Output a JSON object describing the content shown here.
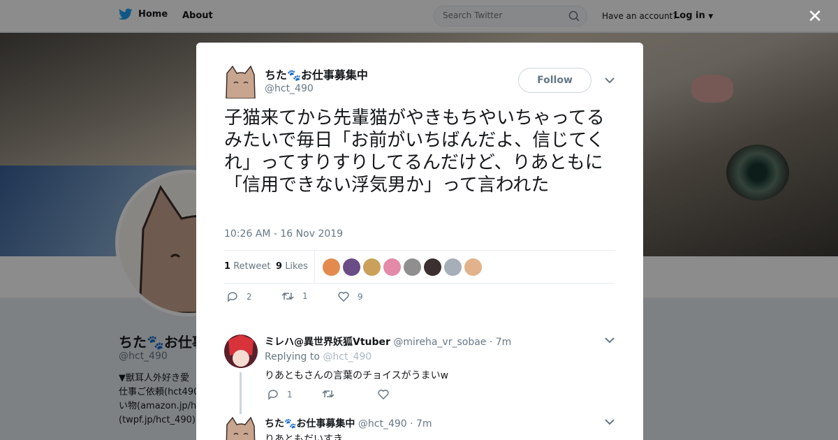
{
  "nav": {
    "home_label": "Home",
    "about_label": "About",
    "search_placeholder": "Search Twitter",
    "have_account": "Have an account?",
    "login_label": "Log in"
  },
  "profile": {
    "name": "ちた🐾お仕事募集中",
    "handle": "@hct_490",
    "bio": "▼獣耳人外好き愛\n仕事ご依頼(hct490\nい物(amazon.jp/h\n(twpf.jp/hct_490)"
  },
  "tweet": {
    "author_name": "ちた🐾お仕事募集中",
    "author_handle": "@hct_490",
    "follow_label": "Follow",
    "text": "子猫来てから先輩猫がやきもちやいちゃってるみたいで毎日「お前がいちばんだよ、信じてくれ」ってすりすりしてるんだけど、りあともに「信用できない浮気男か」って言われた",
    "timestamp": "10:26 AM - 16 Nov 2019",
    "retweet_count": "1",
    "retweet_label": "Retweet",
    "like_count": "9",
    "like_label": "Likes",
    "reply_action_count": "2",
    "retweet_action_count": "1",
    "like_action_count": "9",
    "liker_colors": [
      "#e38a4f",
      "#6a4c86",
      "#c9a15a",
      "#e48aa8",
      "#8f8f8f",
      "#3b2f2f",
      "#a6aeb8",
      "#e2b28a"
    ]
  },
  "replies": [
    {
      "name": "ミレハ@異世界妖狐Vtuber",
      "handle": "@mireha_vr_sobae",
      "time": "· 7m",
      "replying_prefix": "Replying to",
      "replying_to": "@hct_490",
      "text": "りあともさんの言葉のチョイスがうまいw",
      "reply_count": "1",
      "retweet_count": "",
      "like_count": ""
    },
    {
      "name": "ちた🐾お仕事募集中",
      "handle": "@hct_490",
      "time": "· 7m",
      "text": "りあともだいすき……"
    }
  ],
  "colors": {
    "accent": "#1da1f2",
    "muted": "#657786"
  }
}
